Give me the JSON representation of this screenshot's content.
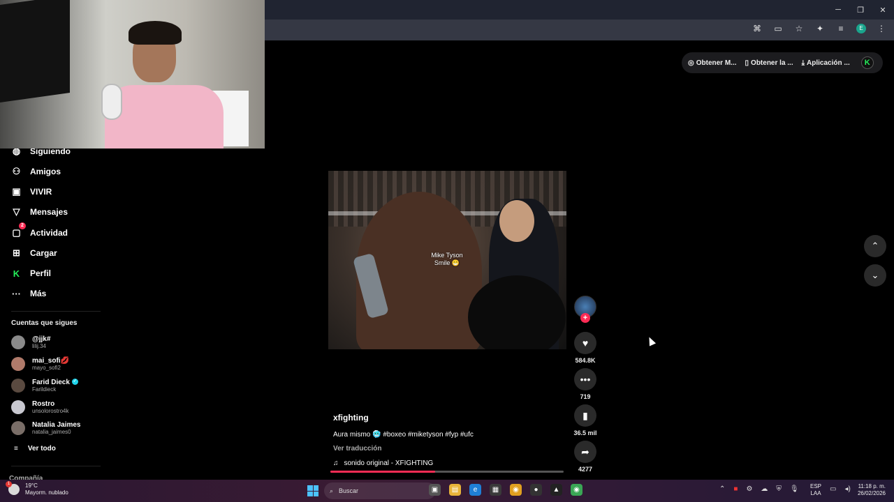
{
  "browser": {
    "window_controls": [
      "─",
      "❐",
      "✕"
    ],
    "toolbar_icons": [
      "translate-icon",
      "cast-icon",
      "star-icon",
      "extensions-icon",
      "media-icon",
      "profile-icon",
      "menu-icon"
    ],
    "profile_initial": "E"
  },
  "top_actions": {
    "items": [
      "Obtener M...",
      "Obtener la ...",
      "Aplicación ..."
    ]
  },
  "sidebar": {
    "nav": [
      {
        "label": "Siguiendo",
        "icon": "following-icon"
      },
      {
        "label": "Amigos",
        "icon": "friends-icon"
      },
      {
        "label": "VIVIR",
        "icon": "live-icon"
      },
      {
        "label": "Mensajes",
        "icon": "messages-icon"
      },
      {
        "label": "Actividad",
        "icon": "activity-icon",
        "badge": "2"
      },
      {
        "label": "Cargar",
        "icon": "upload-icon"
      },
      {
        "label": "Perfil",
        "icon": "profile-icon"
      },
      {
        "label": "Más",
        "icon": "more-icon"
      }
    ],
    "following_title": "Cuentas que sigues",
    "accounts": [
      {
        "name": "@jjk#",
        "handle": "lilij.34",
        "color": "#8a8a8a"
      },
      {
        "name": "mai_sofi💋",
        "handle": "mayo_sofi2",
        "color": "#b07a6a"
      },
      {
        "name": "Farid Dieck",
        "handle": "Farildieck",
        "color": "#5a4a40",
        "verified": true
      },
      {
        "name": "Rostro",
        "handle": "unsolorostro4k",
        "color": "#c8c8d0"
      },
      {
        "name": "Natalia Jaimes",
        "handle": "natalia_jaimes0",
        "color": "#7a6e68"
      }
    ],
    "see_all": "Ver todo",
    "company": "Compañía"
  },
  "video": {
    "caption_overlay": "Mike Tyson Smile 😁",
    "progress": 0.45
  },
  "actions": {
    "likes": "584.8K",
    "comments": "719",
    "saves": "36.5 mil",
    "shares": "4277"
  },
  "post": {
    "username": "xfighting",
    "description": "Aura mismo 🥶 #boxeo #miketyson #fyp #ufc",
    "translate": "Ver traducción",
    "sound": "sonido original - XFIGHTING"
  },
  "taskbar": {
    "weather_temp": "19°C",
    "weather_desc": "Mayorm. nublado",
    "weather_badge": "1",
    "search_placeholder": "Buscar",
    "lang_line1": "ESP",
    "lang_line2": "LAA",
    "time": "11:18 p. m.",
    "date": "26/02/2026"
  }
}
